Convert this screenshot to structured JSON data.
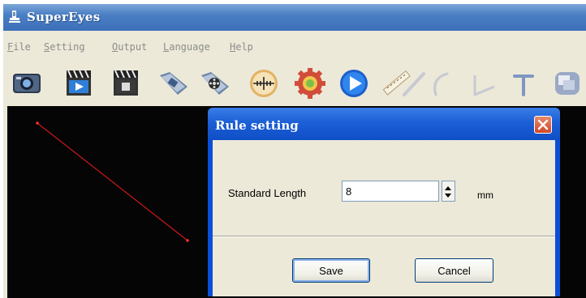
{
  "window": {
    "title": "SuperEyes"
  },
  "menu": [
    {
      "label": "File",
      "accel": "F"
    },
    {
      "label": "Setting",
      "accel": "S"
    },
    {
      "label": "Output",
      "accel": "O"
    },
    {
      "label": "Language",
      "accel": "L"
    },
    {
      "label": "Help",
      "accel": "H"
    }
  ],
  "toolbar": {
    "icons": [
      "camera-icon",
      "video-record-icon",
      "video-stop-icon",
      "photo-folder-icon",
      "video-folder-icon",
      "crosshair-icon",
      "settings-gear-icon",
      "play-icon",
      "ruler-icon",
      "line-icon",
      "arc-icon",
      "angle-icon",
      "text-icon",
      "overlay-icon"
    ]
  },
  "dialog": {
    "title": "Rule setting",
    "field_label": "Standard Length",
    "field_value": "8",
    "unit": "mm",
    "save_label": "Save",
    "cancel_label": "Cancel"
  },
  "colors": {
    "titlebar": "#3c6fb8",
    "dialog_titlebar": "#0f4ec7",
    "window_face": "#ece9d8",
    "canvas": "#050505",
    "measure_line": "#d01818"
  }
}
